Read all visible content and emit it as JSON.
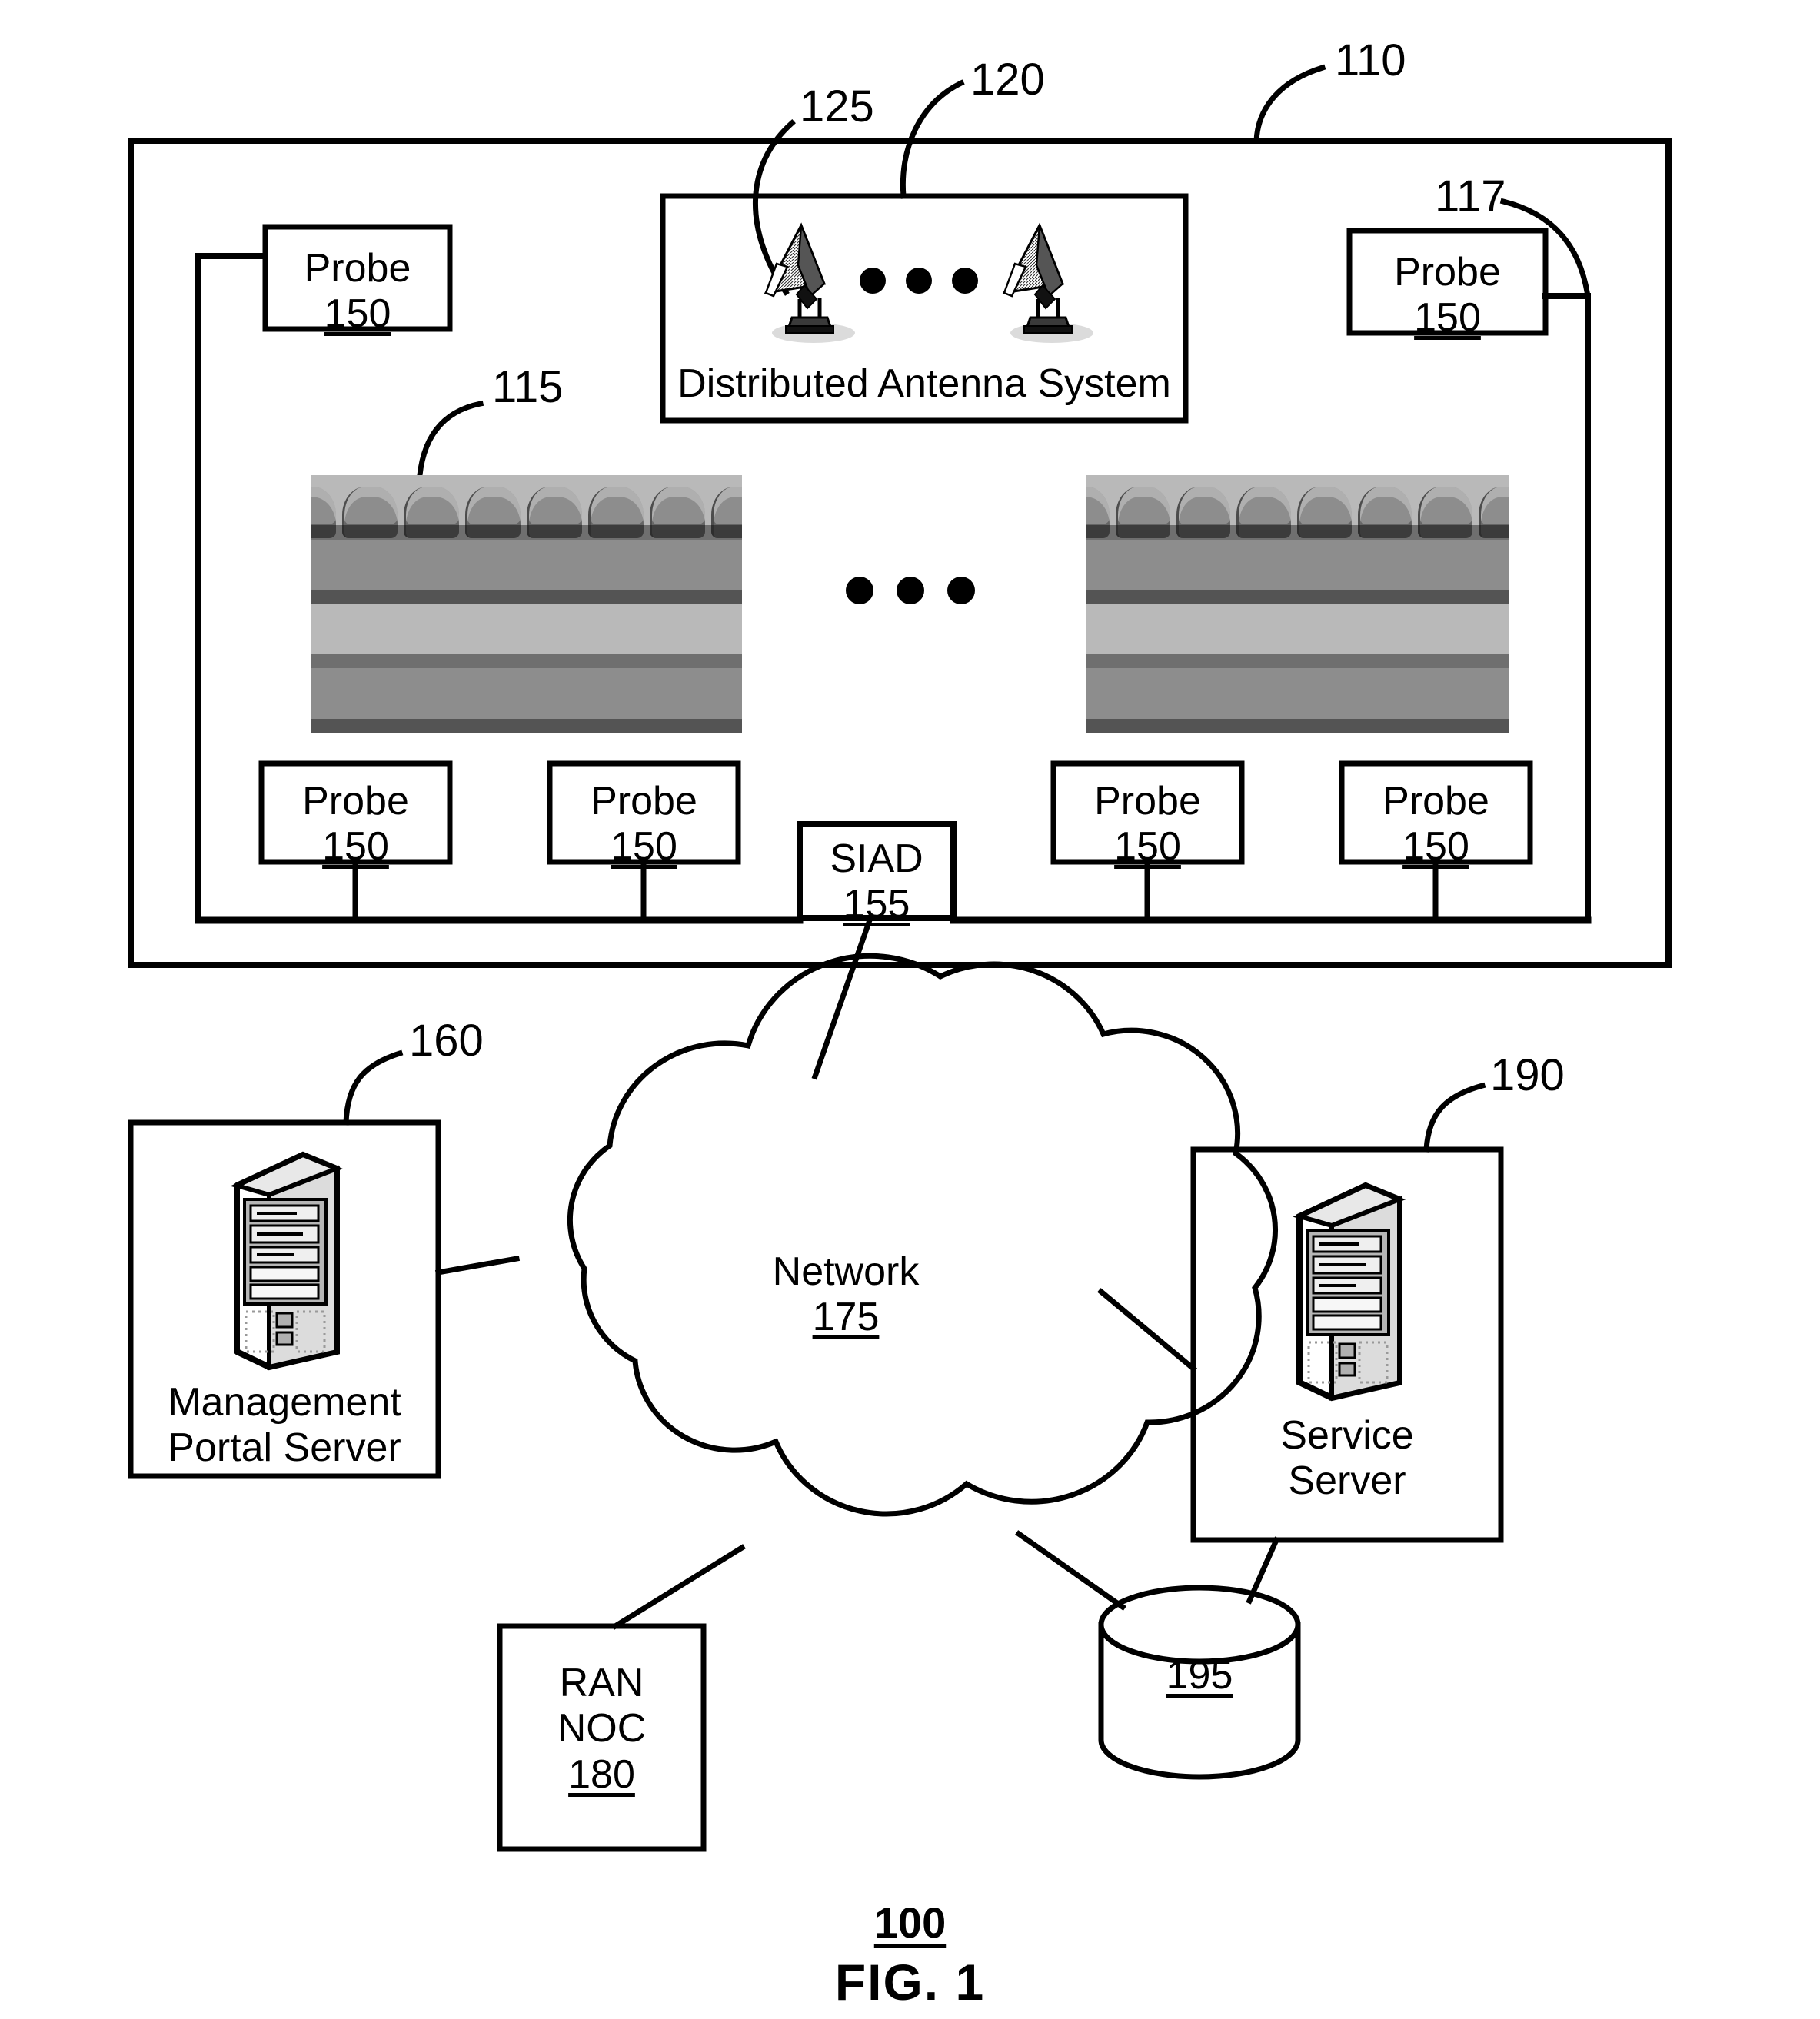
{
  "figure": {
    "caption": "FIG. 1",
    "number": "100"
  },
  "venue": {
    "ref": "110",
    "seating_ref": "115",
    "bus_ref": "117"
  },
  "das": {
    "ref": "120",
    "antenna_ref": "125",
    "label": "Distributed Antenna System",
    "ellipsis": "• • •"
  },
  "seating_ellipsis": "• • •",
  "probes": [
    {
      "name": "Probe",
      "num": "150"
    },
    {
      "name": "Probe",
      "num": "150"
    },
    {
      "name": "Probe",
      "num": "150"
    },
    {
      "name": "Probe",
      "num": "150"
    },
    {
      "name": "Probe",
      "num": "150"
    },
    {
      "name": "Probe",
      "num": "150"
    }
  ],
  "siad": {
    "name": "SIAD",
    "num": "155"
  },
  "network": {
    "name": "Network",
    "num": "175"
  },
  "management_portal_server": {
    "line1": "Management",
    "line2": "Portal Server",
    "ref": "160"
  },
  "service_server": {
    "line1": "Service",
    "line2": "Server",
    "ref": "190"
  },
  "ran_noc": {
    "line1": "RAN",
    "line2": "NOC",
    "num": "180"
  },
  "database": {
    "num": "195"
  },
  "colors": {
    "stroke": "#000000",
    "background": "#ffffff",
    "seat_light": "#b9b9b9",
    "seat_mid": "#8d8d8d",
    "seat_dark": "#555555"
  }
}
